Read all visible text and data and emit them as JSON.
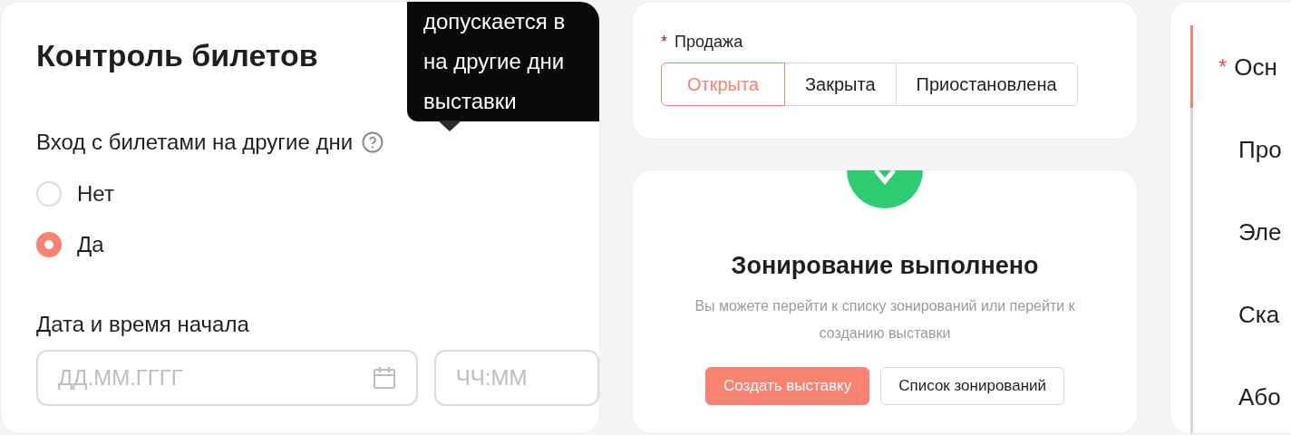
{
  "ticket_control": {
    "title": "Контроль билетов",
    "tooltip": {
      "lines": [
        "допускается в",
        "на другие дни",
        "выставки"
      ]
    },
    "question": {
      "label": "Вход с билетами на другие дни"
    },
    "options": [
      {
        "label": "Нет",
        "selected": false
      },
      {
        "label": "Да",
        "selected": true
      }
    ],
    "start": {
      "label": "Дата и время начала",
      "date_placeholder": "ДД.ММ.ГГГГ",
      "time_placeholder": "ЧЧ:ММ"
    }
  },
  "sale": {
    "label": "Продажа",
    "required_mark": "*",
    "segments": [
      {
        "label": "Открыта",
        "selected": true
      },
      {
        "label": "Закрыта",
        "selected": false
      },
      {
        "label": "Приостановлена",
        "selected": false
      }
    ]
  },
  "result": {
    "title": "Зонирование выполнено",
    "text": "Вы можете перейти к списку зонирований или перейти к созданию выставки",
    "buttons": [
      {
        "label": "Создать выставку",
        "kind": "primary"
      },
      {
        "label": "Список зонирований",
        "kind": "default"
      }
    ]
  },
  "steps": [
    {
      "label": "Осн",
      "required_mark": "*",
      "selected": true
    },
    {
      "label": "Про",
      "selected": false
    },
    {
      "label": "Эле",
      "selected": false
    },
    {
      "label": "Ска",
      "selected": false
    },
    {
      "label": "Або",
      "selected": false
    }
  ]
}
